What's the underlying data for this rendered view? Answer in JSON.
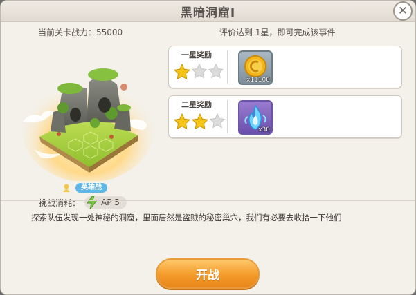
{
  "dialog": {
    "title": "黑暗洞窟Ⅰ",
    "close_symbol": "✕"
  },
  "stage": {
    "power_text": "当前关卡战力：55000",
    "mode_label": "英雄战",
    "cost_label": "挑战消耗：",
    "cost_value": "AP  5",
    "icons": {
      "cost": "lightning-bolt-icon",
      "mode": "hero-icon",
      "island": "floating-island-image"
    }
  },
  "rewards": {
    "condition_text": "评价达到 1星，即可完成该事件",
    "tiers": [
      {
        "title": "一星奖励",
        "filled_stars": 1,
        "total_stars": 3,
        "item_icon": "gold-coin-icon",
        "quantity": "x11100"
      },
      {
        "title": "二星奖励",
        "filled_stars": 2,
        "total_stars": 3,
        "item_icon": "blue-flame-icon",
        "quantity": "x30"
      }
    ]
  },
  "description": "探索队伍发现一处神秘的洞窟，里面居然是盗贼的秘密巢穴，我们有必要去收拾一下他们",
  "action": {
    "start_label": "开战"
  },
  "colors": {
    "accent_orange": "#f39b2a",
    "hero_badge": "#5fb7e6",
    "star_gold": "#f5c419"
  }
}
